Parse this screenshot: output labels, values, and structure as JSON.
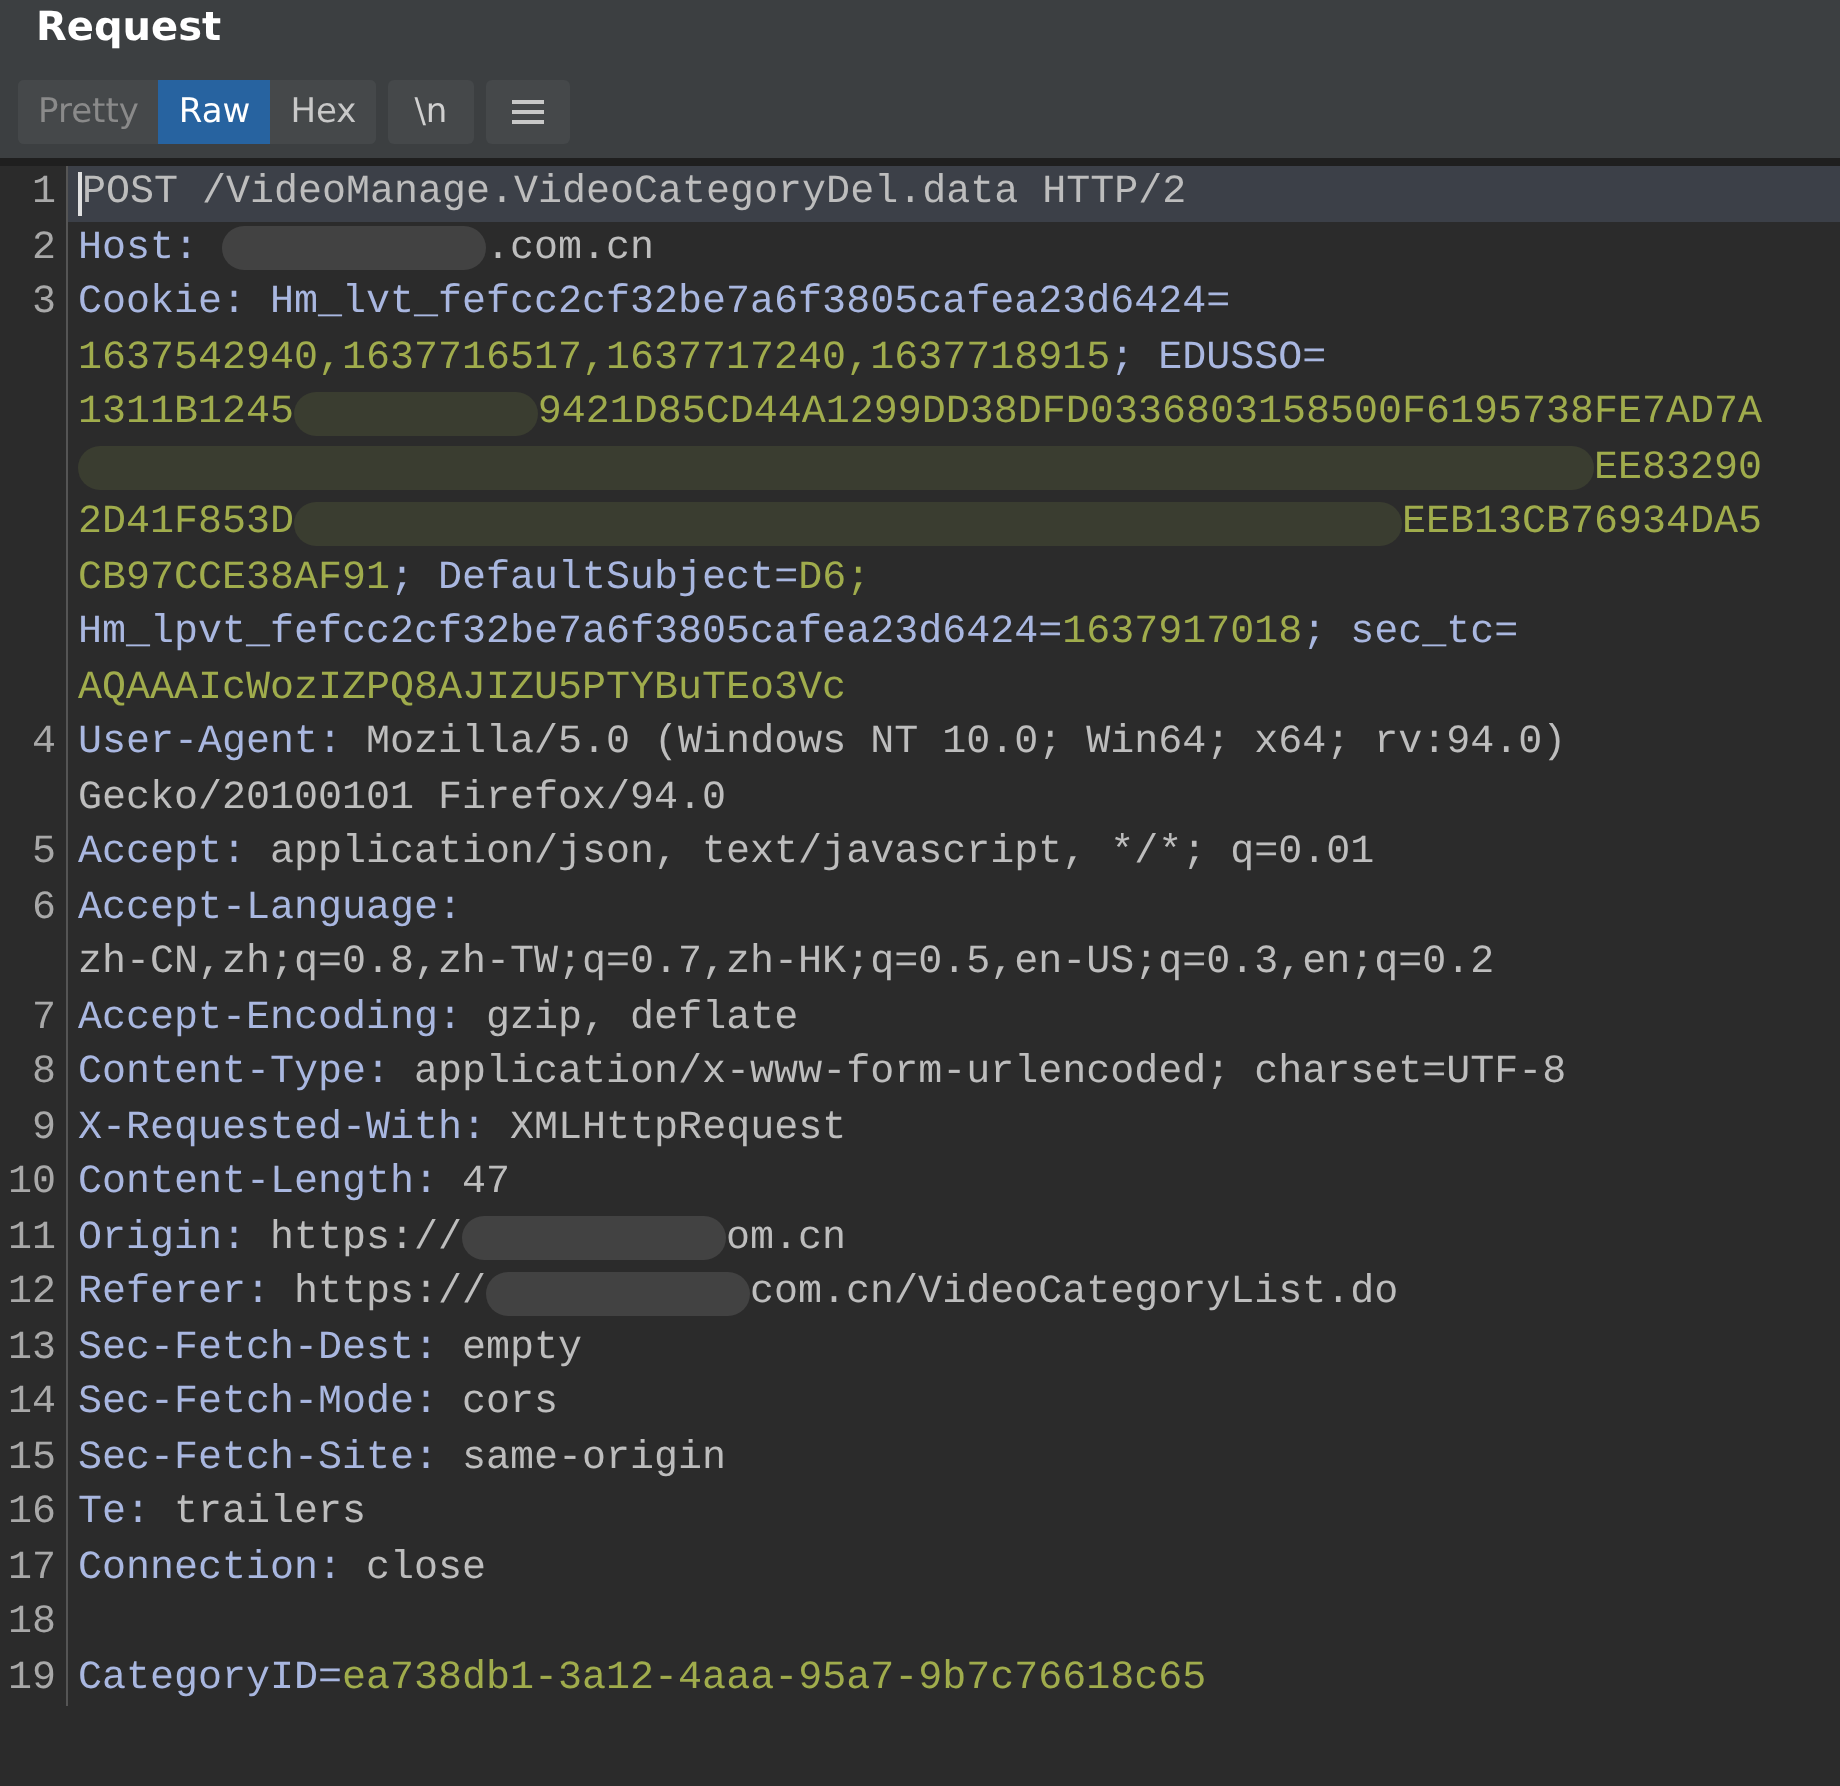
{
  "panel": {
    "title": "Request"
  },
  "tabs": [
    {
      "label": "Pretty",
      "selected": false
    },
    {
      "label": "Raw",
      "selected": true
    },
    {
      "label": "Hex",
      "selected": false
    }
  ],
  "buttons": [
    {
      "kind": "text",
      "label": "\\n"
    },
    {
      "kind": "menu"
    }
  ],
  "editor": {
    "lines": [
      {
        "number": "1",
        "current": true,
        "wraps": [
          {
            "tokens": [
              {
                "kind": "value",
                "text": "POST /VideoManage.VideoCategoryDel.data HTTP/2"
              }
            ]
          }
        ]
      },
      {
        "number": "2",
        "current": false,
        "wraps": [
          {
            "tokens": [
              {
                "kind": "name",
                "text": "Host: "
              },
              {
                "kind": "redacted"
              },
              {
                "kind": "value",
                "text": ".com.cn"
              }
            ]
          }
        ]
      },
      {
        "number": "3",
        "current": false,
        "wraps": [
          {
            "tokens": [
              {
                "kind": "name",
                "text": "Cookie: Hm_lvt_fefcc2cf32be7a6f3805cafea23d6424="
              }
            ]
          },
          {
            "tokens": [
              {
                "kind": "cookie",
                "text": "1637542940,1637716517,1637717240,1637718915"
              },
              {
                "kind": "name",
                "text": "; EDUSSO="
              }
            ]
          },
          {
            "tokens": [
              {
                "kind": "cookie",
                "text": "1311B1245"
              },
              {
                "kind": "redacted"
              },
              {
                "kind": "cookie",
                "text": "9421D85CD44A1299DD38DFD0336803158500F6195738FE7AD7A"
              }
            ]
          },
          {
            "tokens": [
              {
                "kind": "redacted"
              },
              {
                "kind": "cookie",
                "text": "EE83290"
              }
            ]
          },
          {
            "tokens": [
              {
                "kind": "cookie",
                "text": "2D41F853D"
              },
              {
                "kind": "redacted"
              },
              {
                "kind": "cookie",
                "text": "EEB13CB76934DA5"
              }
            ]
          },
          {
            "tokens": [
              {
                "kind": "cookie",
                "text": "CB97CCE38AF91"
              },
              {
                "kind": "name",
                "text": "; DefaultSubject="
              },
              {
                "kind": "cookie",
                "text": "D6;"
              }
            ]
          },
          {
            "tokens": [
              {
                "kind": "name",
                "text": "Hm_lpvt_fefcc2cf32be7a6f3805cafea23d6424="
              },
              {
                "kind": "cookie",
                "text": "1637917018"
              },
              {
                "kind": "name",
                "text": "; sec_tc="
              }
            ]
          },
          {
            "tokens": [
              {
                "kind": "cookie",
                "text": "AQAAAIcWozIZPQ8AJIZU5PTYBuTEo3Vc"
              }
            ]
          }
        ]
      },
      {
        "number": "4",
        "current": false,
        "wraps": [
          {
            "tokens": [
              {
                "kind": "name",
                "text": "User-Agent: "
              },
              {
                "kind": "value",
                "text": "Mozilla/5.0 (Windows NT 10.0; Win64; x64; rv:94.0)"
              }
            ]
          },
          {
            "tokens": [
              {
                "kind": "value",
                "text": "Gecko/20100101 Firefox/94.0"
              }
            ]
          }
        ]
      },
      {
        "number": "5",
        "current": false,
        "wraps": [
          {
            "tokens": [
              {
                "kind": "name",
                "text": "Accept: "
              },
              {
                "kind": "value",
                "text": "application/json, text/javascript, */*; q=0.01"
              }
            ]
          }
        ]
      },
      {
        "number": "6",
        "current": false,
        "wraps": [
          {
            "tokens": [
              {
                "kind": "name",
                "text": "Accept-Language:"
              }
            ]
          },
          {
            "tokens": [
              {
                "kind": "value",
                "text": "zh-CN,zh;q=0.8,zh-TW;q=0.7,zh-HK;q=0.5,en-US;q=0.3,en;q=0.2"
              }
            ]
          }
        ]
      },
      {
        "number": "7",
        "current": false,
        "wraps": [
          {
            "tokens": [
              {
                "kind": "name",
                "text": "Accept-Encoding: "
              },
              {
                "kind": "value",
                "text": "gzip, deflate"
              }
            ]
          }
        ]
      },
      {
        "number": "8",
        "current": false,
        "wraps": [
          {
            "tokens": [
              {
                "kind": "name",
                "text": "Content-Type: "
              },
              {
                "kind": "value",
                "text": "application/x-www-form-urlencoded; charset=UTF-8"
              }
            ]
          }
        ]
      },
      {
        "number": "9",
        "current": false,
        "wraps": [
          {
            "tokens": [
              {
                "kind": "name",
                "text": "X-Requested-With: "
              },
              {
                "kind": "value",
                "text": "XMLHttpRequest"
              }
            ]
          }
        ]
      },
      {
        "number": "10",
        "current": false,
        "wraps": [
          {
            "tokens": [
              {
                "kind": "name",
                "text": "Content-Length: "
              },
              {
                "kind": "value",
                "text": "47"
              }
            ]
          }
        ]
      },
      {
        "number": "11",
        "current": false,
        "wraps": [
          {
            "tokens": [
              {
                "kind": "name",
                "text": "Origin: "
              },
              {
                "kind": "value",
                "text": "https://"
              },
              {
                "kind": "redacted"
              },
              {
                "kind": "value",
                "text": "om.cn"
              }
            ]
          }
        ]
      },
      {
        "number": "12",
        "current": false,
        "wraps": [
          {
            "tokens": [
              {
                "kind": "name",
                "text": "Referer: "
              },
              {
                "kind": "value",
                "text": "https://"
              },
              {
                "kind": "redacted"
              },
              {
                "kind": "value",
                "text": "com.cn/VideoCategoryList.do"
              }
            ]
          }
        ]
      },
      {
        "number": "13",
        "current": false,
        "wraps": [
          {
            "tokens": [
              {
                "kind": "name",
                "text": "Sec-Fetch-Dest: "
              },
              {
                "kind": "value",
                "text": "empty"
              }
            ]
          }
        ]
      },
      {
        "number": "14",
        "current": false,
        "wraps": [
          {
            "tokens": [
              {
                "kind": "name",
                "text": "Sec-Fetch-Mode: "
              },
              {
                "kind": "value",
                "text": "cors"
              }
            ]
          }
        ]
      },
      {
        "number": "15",
        "current": false,
        "wraps": [
          {
            "tokens": [
              {
                "kind": "name",
                "text": "Sec-Fetch-Site: "
              },
              {
                "kind": "value",
                "text": "same-origin"
              }
            ]
          }
        ]
      },
      {
        "number": "16",
        "current": false,
        "wraps": [
          {
            "tokens": [
              {
                "kind": "name",
                "text": "Te: "
              },
              {
                "kind": "value",
                "text": "trailers"
              }
            ]
          }
        ]
      },
      {
        "number": "17",
        "current": false,
        "wraps": [
          {
            "tokens": [
              {
                "kind": "name",
                "text": "Connection: "
              },
              {
                "kind": "value",
                "text": "close"
              }
            ]
          }
        ]
      },
      {
        "number": "18",
        "current": false
      },
      {
        "number": "19",
        "current": false,
        "wraps": [
          {
            "tokens": [
              {
                "kind": "name",
                "text": "CategoryID="
              },
              {
                "kind": "cookie",
                "text": "ea738db1-3a12-4aaa-95a7-9b7c76618c65"
              }
            ]
          }
        ]
      }
    ]
  }
}
